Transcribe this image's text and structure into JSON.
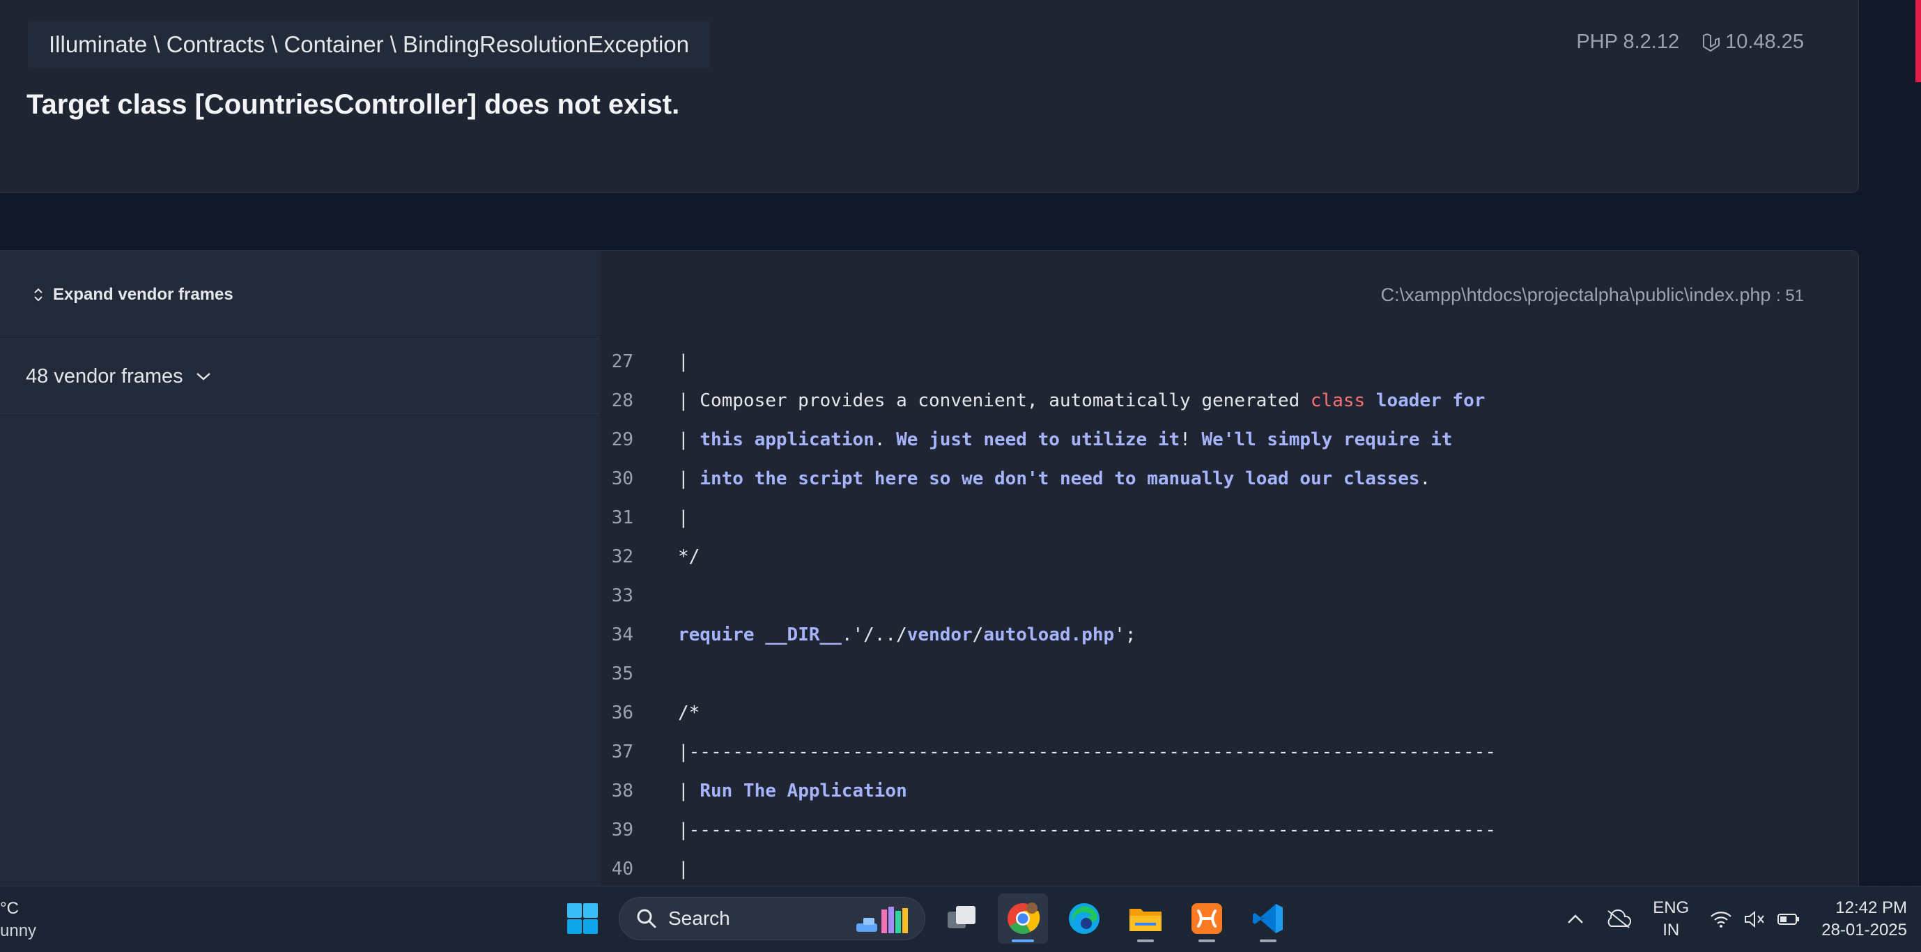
{
  "header": {
    "exception_class": "Illuminate \\ Contracts \\ Container \\ BindingResolutionException",
    "message": "Target class [CountriesController] does not exist.",
    "php_version": "PHP 8.2.12",
    "laravel_version": "10.48.25"
  },
  "frames": {
    "expand_label": "Expand vendor frames",
    "vendor_frames_label": "48 vendor frames"
  },
  "code_view": {
    "file_path": "C:\\xampp\\htdocs\\projectalpha\\public\\index.php",
    "line_number": ": 51",
    "lines": [
      {
        "num": "27",
        "text": "|"
      },
      {
        "num": "28",
        "text": "| Composer provides a convenient, automatically generated class loader for"
      },
      {
        "num": "29",
        "text": "| this application. We just need to utilize it! We'll simply require it"
      },
      {
        "num": "30",
        "text": "| into the script here so we don't need to manually load our classes."
      },
      {
        "num": "31",
        "text": "|"
      },
      {
        "num": "32",
        "text": "*/"
      },
      {
        "num": "33",
        "text": ""
      },
      {
        "num": "34",
        "text": "require __DIR__.'/../vendor/autoload.php';"
      },
      {
        "num": "35",
        "text": ""
      },
      {
        "num": "36",
        "text": "/*"
      },
      {
        "num": "37",
        "text": "|--------------------------------------------------------------------------"
      },
      {
        "num": "38",
        "text": "| Run The Application"
      },
      {
        "num": "39",
        "text": "|--------------------------------------------------------------------------"
      },
      {
        "num": "40",
        "text": "|"
      }
    ]
  },
  "taskbar": {
    "weather_temp": "°C",
    "weather_desc": "unny",
    "search_label": "Search",
    "lang_line1": "ENG",
    "lang_line2": "IN",
    "time": "12:42 PM",
    "date": "28-01-2025"
  },
  "colors": {
    "accent": "#e11d48",
    "keyword": "#a5b4fc",
    "string_red": "#f87171",
    "panel": "#1f2533"
  }
}
